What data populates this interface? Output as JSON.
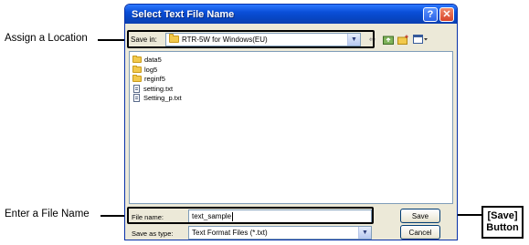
{
  "annotations": {
    "assign_location": "Assign a Location",
    "enter_file_name": "Enter a File Name",
    "save_button_line1": "[Save]",
    "save_button_line2": "Button"
  },
  "dialog": {
    "title": "Select Text File Name",
    "help_glyph": "?",
    "close_glyph": "✕",
    "save_in": {
      "label": "Save in:",
      "value": "RTR-5W for Windows(EU)"
    },
    "toolbar_icons": [
      "back-arrow-icon",
      "up-folder-icon",
      "new-folder-icon",
      "views-menu-icon"
    ],
    "files": [
      {
        "name": "data5",
        "type": "folder"
      },
      {
        "name": "log5",
        "type": "folder"
      },
      {
        "name": "reginf5",
        "type": "folder"
      },
      {
        "name": "setting.txt",
        "type": "file"
      },
      {
        "name": "Setting_p.txt",
        "type": "file"
      }
    ],
    "file_name": {
      "label": "File name:",
      "value": "text_sample"
    },
    "save_as_type": {
      "label": "Save as type:",
      "value": "Text Format Files (*.txt)"
    },
    "buttons": {
      "save": "Save",
      "cancel": "Cancel"
    }
  }
}
